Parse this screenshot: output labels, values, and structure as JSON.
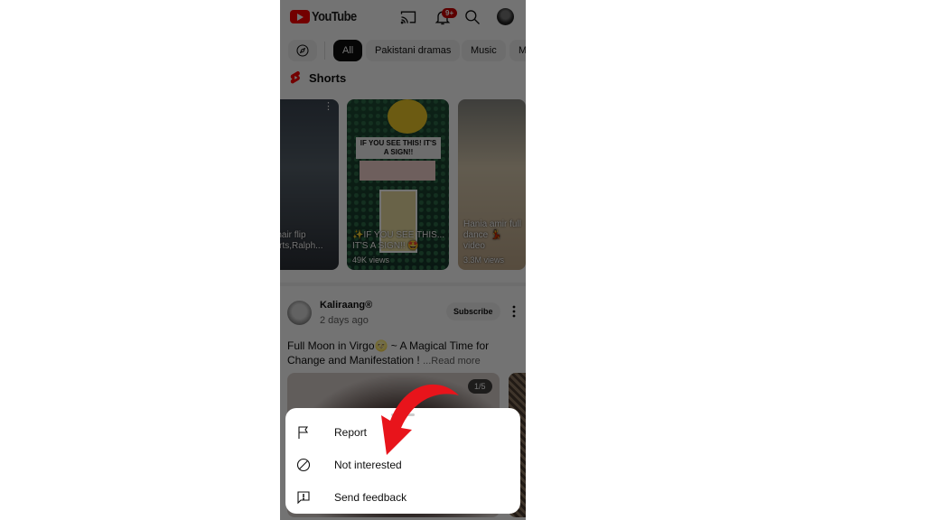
{
  "app": {
    "name": "YouTube"
  },
  "topbar": {
    "logo_text": "YouTube",
    "icons": [
      "cast-icon",
      "notifications-icon",
      "search-icon",
      "account-avatar"
    ],
    "notification_badge": "9+"
  },
  "chips": {
    "explore_icon": "compass-icon",
    "items": [
      {
        "label": "All",
        "active": true
      },
      {
        "label": "Pakistani dramas",
        "active": false
      },
      {
        "label": "Music",
        "active": false
      },
      {
        "label": "M",
        "active": false
      }
    ]
  },
  "shorts": {
    "heading": "Shorts",
    "items": [
      {
        "title": "d hair flip\nhorts,Ralph...",
        "views": ""
      },
      {
        "caption": "IF YOU SEE THIS! IT'S A SIGN!!",
        "title": "✨IF YOU SEE THIS... IT'S A SIGN!! 🤩",
        "views": "49K views"
      },
      {
        "title": "Hania amir full dance 💃 video",
        "views": "3.3M views"
      }
    ]
  },
  "post": {
    "channel": "Kaliraang®",
    "time": "2 days ago",
    "subscribe_label": "Subscribe",
    "text": "Full Moon in Virgo🌝 ~ A Magical Time for Change and Manifestation ! ",
    "read_more": "...Read more",
    "image_counter": "1/5"
  },
  "sheet": {
    "items": [
      {
        "label": "Report",
        "icon": "flag-icon"
      },
      {
        "label": "Not interested",
        "icon": "block-icon"
      },
      {
        "label": "Send feedback",
        "icon": "feedback-icon"
      }
    ]
  },
  "colors": {
    "brand_red": "#ff0000",
    "annotation_arrow": "#e8141b",
    "badge": "#cc0000"
  }
}
